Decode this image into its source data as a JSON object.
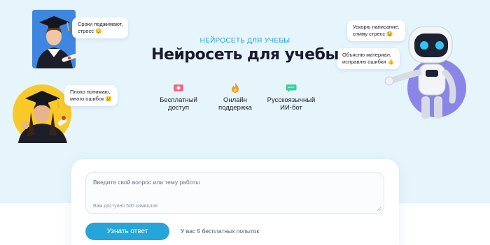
{
  "hero": {
    "eyebrow": "НЕЙРОСЕТЬ ДЛЯ УЧЕБЫ",
    "title": "Нейросеть для учебы"
  },
  "features": [
    {
      "icon": "ticket-icon",
      "label": "Бесплатный\nдоступ"
    },
    {
      "icon": "flame-icon",
      "label": "Онлайн\nподдержка"
    },
    {
      "icon": "chat-icon",
      "label": "Русскоязычный\nИИ-бот"
    }
  ],
  "bubbles": {
    "top_left": "Сроки поджимают,\nстресс 😔",
    "mid_left": "Плохо понимаю,\nмного ошибок 😢",
    "top_right": "Ускорю написание,\nсниму стресс 😉",
    "mid_right": "Объясню материал,\nисправлю ошибки 👍"
  },
  "form": {
    "placeholder": "Введите свой вопрос или тему работы",
    "counter": "Вам доступно 500 символов",
    "submit_label": "Узнать ответ",
    "attempts": "У вас 5 бесплатных попыток"
  },
  "colors": {
    "accent": "#26a6d8",
    "hero_bg": "#e6f5fc"
  }
}
